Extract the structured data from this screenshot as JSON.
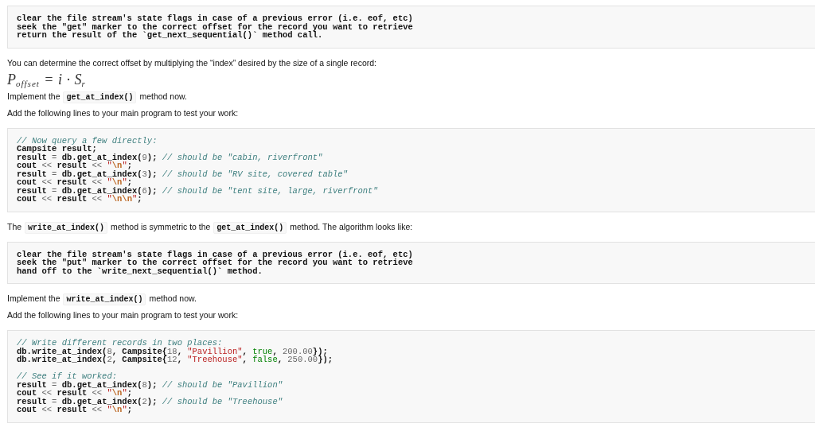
{
  "document": {
    "blocks": [
      {
        "kind": "code_block",
        "lines": [
          {
            "kind": "code",
            "tokens": [
              {
                "kind": "plain",
                "text": "clear the file stream's state flags in case of a previous error (i.e. eof, etc)"
              }
            ]
          },
          {
            "kind": "code",
            "tokens": [
              {
                "kind": "plain",
                "text": "seek the \"get\" marker to the correct offset for the record you want to retrieve"
              }
            ]
          },
          {
            "kind": "code",
            "tokens": [
              {
                "kind": "plain",
                "text": "return the result of the `get_next_sequential()` method call."
              }
            ]
          }
        ]
      },
      {
        "kind": "paragraph",
        "segments": [
          {
            "kind": "text",
            "text": "You can determine the correct offset by multiplying the “index” desired by the size of a single record:"
          }
        ]
      },
      {
        "kind": "formula",
        "text": "P$_{offset}$ = i · S$_{r}$"
      },
      {
        "kind": "paragraph",
        "segments": [
          {
            "kind": "text",
            "text": "Implement the "
          },
          {
            "kind": "code",
            "text": "get_at_index()"
          },
          {
            "kind": "text",
            "text": " method now."
          }
        ]
      },
      {
        "kind": "paragraph",
        "segments": [
          {
            "kind": "text",
            "text": "Add the following lines to your main program to test your work:"
          }
        ]
      },
      {
        "kind": "code_block",
        "lines": [
          {
            "kind": "code",
            "tokens": [
              {
                "kind": "comment",
                "text": "// Now query a few directly:"
              }
            ]
          },
          {
            "kind": "code",
            "tokens": [
              {
                "kind": "plain",
                "text": "Campsite result;"
              }
            ]
          },
          {
            "kind": "code",
            "tokens": [
              {
                "kind": "plain",
                "text": "result "
              },
              {
                "kind": "operator",
                "text": "="
              },
              {
                "kind": "plain",
                "text": " db.get_at_index("
              },
              {
                "kind": "number",
                "text": "9"
              },
              {
                "kind": "plain",
                "text": "); "
              },
              {
                "kind": "comment",
                "text": "// should be \"cabin, riverfront\""
              }
            ]
          },
          {
            "kind": "code",
            "tokens": [
              {
                "kind": "plain",
                "text": "cout "
              },
              {
                "kind": "operator",
                "text": "<<"
              },
              {
                "kind": "plain",
                "text": " result "
              },
              {
                "kind": "operator",
                "text": "<< "
              },
              {
                "kind": "string",
                "text": "\""
              },
              {
                "kind": "escape",
                "text": "\\n"
              },
              {
                "kind": "string",
                "text": "\""
              },
              {
                "kind": "plain",
                "text": ";"
              }
            ]
          },
          {
            "kind": "code",
            "tokens": [
              {
                "kind": "plain",
                "text": "result "
              },
              {
                "kind": "operator",
                "text": "="
              },
              {
                "kind": "plain",
                "text": " db.get_at_index("
              },
              {
                "kind": "number",
                "text": "3"
              },
              {
                "kind": "plain",
                "text": "); "
              },
              {
                "kind": "comment",
                "text": "// should be \"RV site, covered table\""
              }
            ]
          },
          {
            "kind": "code",
            "tokens": [
              {
                "kind": "plain",
                "text": "cout "
              },
              {
                "kind": "operator",
                "text": "<<"
              },
              {
                "kind": "plain",
                "text": " result "
              },
              {
                "kind": "operator",
                "text": "<< "
              },
              {
                "kind": "string",
                "text": "\""
              },
              {
                "kind": "escape",
                "text": "\\n"
              },
              {
                "kind": "string",
                "text": "\""
              },
              {
                "kind": "plain",
                "text": ";"
              }
            ]
          },
          {
            "kind": "code",
            "tokens": [
              {
                "kind": "plain",
                "text": "result "
              },
              {
                "kind": "operator",
                "text": "="
              },
              {
                "kind": "plain",
                "text": " db.get_at_index("
              },
              {
                "kind": "number",
                "text": "6"
              },
              {
                "kind": "plain",
                "text": "); "
              },
              {
                "kind": "comment",
                "text": "// should be \"tent site, large, riverfront\""
              }
            ]
          },
          {
            "kind": "code",
            "tokens": [
              {
                "kind": "plain",
                "text": "cout "
              },
              {
                "kind": "operator",
                "text": "<<"
              },
              {
                "kind": "plain",
                "text": " result "
              },
              {
                "kind": "operator",
                "text": "<< "
              },
              {
                "kind": "string",
                "text": "\""
              },
              {
                "kind": "escape",
                "text": "\\n\\n"
              },
              {
                "kind": "string",
                "text": "\""
              },
              {
                "kind": "plain",
                "text": ";"
              }
            ]
          }
        ]
      },
      {
        "kind": "paragraph",
        "segments": [
          {
            "kind": "text",
            "text": "The "
          },
          {
            "kind": "code",
            "text": "write_at_index()"
          },
          {
            "kind": "text",
            "text": " method is symmetric to the "
          },
          {
            "kind": "code",
            "text": "get_at_index()"
          },
          {
            "kind": "text",
            "text": " method. The algorithm looks like:"
          }
        ]
      },
      {
        "kind": "code_block",
        "lines": [
          {
            "kind": "code",
            "tokens": [
              {
                "kind": "plain",
                "text": "clear the file stream's state flags in case of a previous error (i.e. eof, etc)"
              }
            ]
          },
          {
            "kind": "code",
            "tokens": [
              {
                "kind": "plain",
                "text": "seek the \"put\" marker to the correct offset for the record you want to retrieve"
              }
            ]
          },
          {
            "kind": "code",
            "tokens": [
              {
                "kind": "plain",
                "text": "hand off to the `write_next_sequential()` method."
              }
            ]
          }
        ]
      },
      {
        "kind": "paragraph",
        "segments": [
          {
            "kind": "text",
            "text": "Implement the "
          },
          {
            "kind": "code",
            "text": "write_at_index()"
          },
          {
            "kind": "text",
            "text": " method now."
          }
        ]
      },
      {
        "kind": "paragraph",
        "segments": [
          {
            "kind": "text",
            "text": "Add the following lines to your main program to test your work:"
          }
        ]
      },
      {
        "kind": "code_block",
        "lines": [
          {
            "kind": "code",
            "tokens": [
              {
                "kind": "comment",
                "text": "// Write different records in two places:"
              }
            ]
          },
          {
            "kind": "code",
            "tokens": [
              {
                "kind": "plain",
                "text": "db.write_at_index("
              },
              {
                "kind": "number",
                "text": "8"
              },
              {
                "kind": "plain",
                "text": ", Campsite{"
              },
              {
                "kind": "number",
                "text": "18"
              },
              {
                "kind": "plain",
                "text": ", "
              },
              {
                "kind": "string",
                "text": "\"Pavillion\""
              },
              {
                "kind": "plain",
                "text": ", "
              },
              {
                "kind": "constant",
                "text": "true"
              },
              {
                "kind": "plain",
                "text": ", "
              },
              {
                "kind": "number",
                "text": "200.00"
              },
              {
                "kind": "plain",
                "text": "});"
              }
            ]
          },
          {
            "kind": "code",
            "tokens": [
              {
                "kind": "plain",
                "text": "db.write_at_index("
              },
              {
                "kind": "number",
                "text": "2"
              },
              {
                "kind": "plain",
                "text": ", Campsite{"
              },
              {
                "kind": "number",
                "text": "12"
              },
              {
                "kind": "plain",
                "text": ", "
              },
              {
                "kind": "string",
                "text": "\"Treehouse\""
              },
              {
                "kind": "plain",
                "text": ", "
              },
              {
                "kind": "constant",
                "text": "false"
              },
              {
                "kind": "plain",
                "text": ", "
              },
              {
                "kind": "number",
                "text": "250.00"
              },
              {
                "kind": "plain",
                "text": "});"
              }
            ]
          },
          {
            "kind": "blank"
          },
          {
            "kind": "code",
            "tokens": [
              {
                "kind": "comment",
                "text": "// See if it worked:"
              }
            ]
          },
          {
            "kind": "code",
            "tokens": [
              {
                "kind": "plain",
                "text": "result "
              },
              {
                "kind": "operator",
                "text": "="
              },
              {
                "kind": "plain",
                "text": " db.get_at_index("
              },
              {
                "kind": "number",
                "text": "8"
              },
              {
                "kind": "plain",
                "text": "); "
              },
              {
                "kind": "comment",
                "text": "// should be \"Pavillion\""
              }
            ]
          },
          {
            "kind": "code",
            "tokens": [
              {
                "kind": "plain",
                "text": "cout "
              },
              {
                "kind": "operator",
                "text": "<<"
              },
              {
                "kind": "plain",
                "text": " result "
              },
              {
                "kind": "operator",
                "text": "<< "
              },
              {
                "kind": "string",
                "text": "\""
              },
              {
                "kind": "escape",
                "text": "\\n"
              },
              {
                "kind": "string",
                "text": "\""
              },
              {
                "kind": "plain",
                "text": ";"
              }
            ]
          },
          {
            "kind": "code",
            "tokens": [
              {
                "kind": "plain",
                "text": "result "
              },
              {
                "kind": "operator",
                "text": "="
              },
              {
                "kind": "plain",
                "text": " db.get_at_index("
              },
              {
                "kind": "number",
                "text": "2"
              },
              {
                "kind": "plain",
                "text": "); "
              },
              {
                "kind": "comment",
                "text": "// should be \"Treehouse\""
              }
            ]
          },
          {
            "kind": "code",
            "tokens": [
              {
                "kind": "plain",
                "text": "cout "
              },
              {
                "kind": "operator",
                "text": "<<"
              },
              {
                "kind": "plain",
                "text": " result "
              },
              {
                "kind": "operator",
                "text": "<< "
              },
              {
                "kind": "string",
                "text": "\""
              },
              {
                "kind": "escape",
                "text": "\\n"
              },
              {
                "kind": "string",
                "text": "\""
              },
              {
                "kind": "plain",
                "text": ";"
              }
            ]
          }
        ]
      }
    ]
  }
}
